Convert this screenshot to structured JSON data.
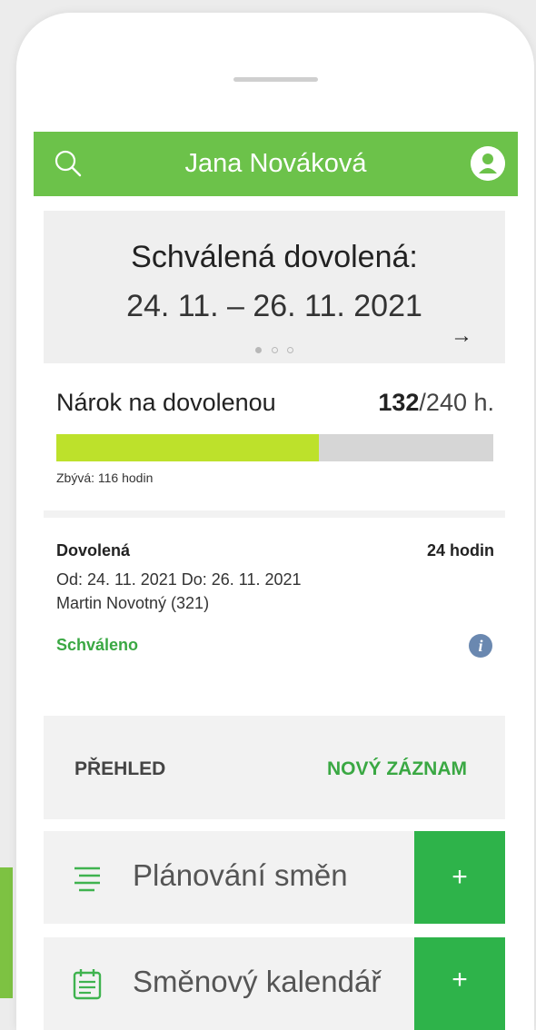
{
  "header": {
    "title": "Jana Nováková"
  },
  "carousel": {
    "heading": "Schválená dovolená:",
    "dates": "24. 11. – 26. 11. 2021",
    "arrow": "→",
    "slide_count": 3,
    "active_slide": 1
  },
  "entitlement": {
    "label": "Nárok na dovolenou",
    "used": "132",
    "total": "/240 h.",
    "remaining": "Zbývá: 116 hodin",
    "progress_fraction": 0.6
  },
  "record": {
    "type": "Dovolená",
    "hours": "24 hodin",
    "range": "Od: 24. 11. 2021   Do: 26. 11. 2021",
    "person": "Martin Novotný (321)",
    "status": "Schváleno",
    "info_glyph": "i"
  },
  "tabs": {
    "overview": "PŘEHLED",
    "new_record": "NOVÝ ZÁZNAM"
  },
  "menu": [
    {
      "label": "Plánování směn",
      "icon": "list-lines-icon",
      "add": "+"
    },
    {
      "label": "Směnový kalendář",
      "icon": "calendar-list-icon",
      "add": "+"
    }
  ],
  "colors": {
    "brand_green": "#6cc24a",
    "progress_fill": "#bde12b",
    "status_green": "#3aa843",
    "button_green": "#2eb34a",
    "info_blue": "#6a88b0"
  }
}
